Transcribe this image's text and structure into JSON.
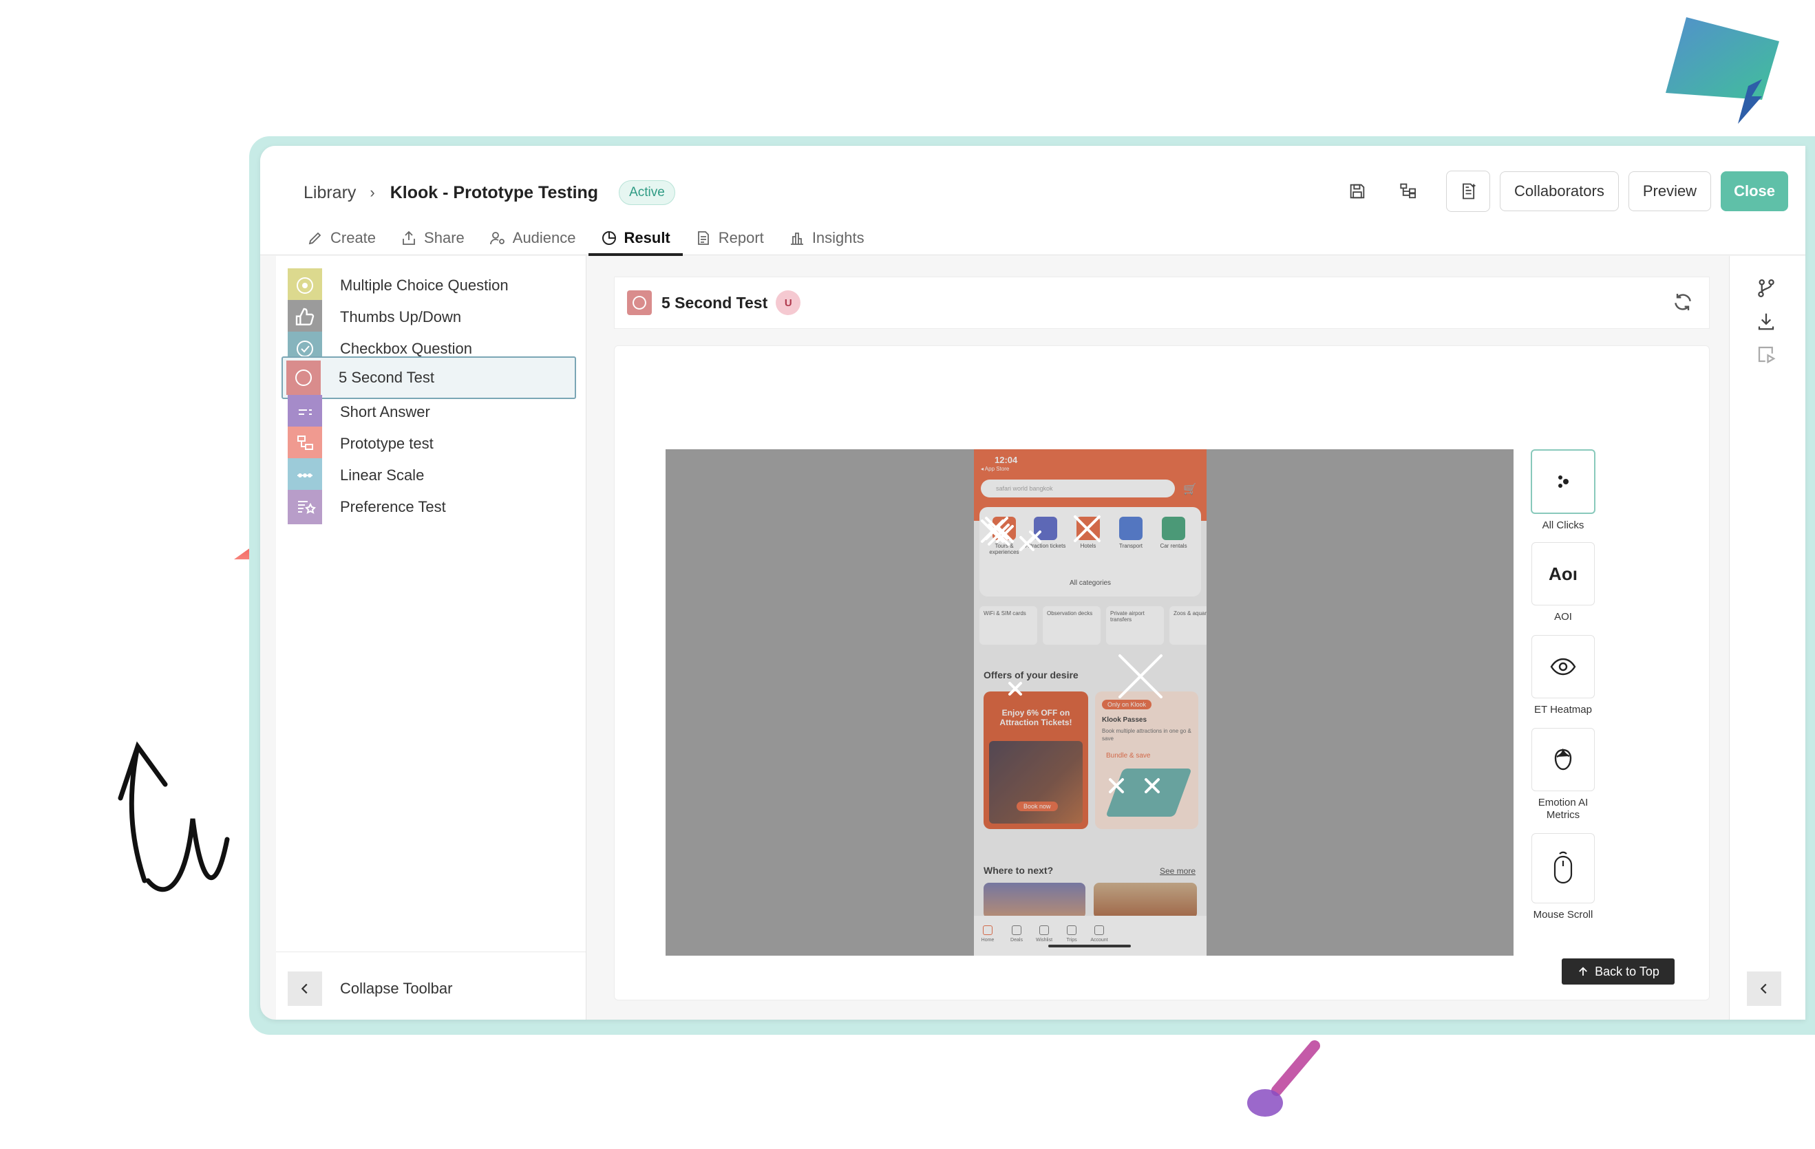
{
  "breadcrumb": {
    "root": "Library",
    "separator": "›",
    "project": "Klook - Prototype Testing",
    "status": "Active"
  },
  "toolbar": {
    "collaborators": "Collaborators",
    "preview": "Preview",
    "close": "Close"
  },
  "tabs": [
    {
      "label": "Create",
      "icon": "pencil-icon"
    },
    {
      "label": "Share",
      "icon": "share-icon"
    },
    {
      "label": "Audience",
      "icon": "audience-icon"
    },
    {
      "label": "Result",
      "icon": "pie-icon",
      "active": true
    },
    {
      "label": "Report",
      "icon": "report-icon"
    },
    {
      "label": "Insights",
      "icon": "bar-chart-icon"
    }
  ],
  "sidebar": {
    "items": [
      {
        "label": "Multiple Choice Question",
        "color": "#dcd98e"
      },
      {
        "label": "Thumbs Up/Down",
        "color": "#9b9b9b"
      },
      {
        "label": "Checkbox Question",
        "color": "#86b4bd"
      },
      {
        "label": "5 Second Test",
        "color": "#d98c8c",
        "selected": true
      },
      {
        "label": "Short Answer",
        "color": "#a58bc9"
      },
      {
        "label": "Prototype test",
        "color": "#f09a90"
      },
      {
        "label": "Linear Scale",
        "color": "#9ccbd9"
      },
      {
        "label": "Preference Test",
        "color": "#b89dc9"
      }
    ],
    "collapse": "Collapse Toolbar"
  },
  "result": {
    "title": "5 Second Test",
    "user_badge": "U"
  },
  "phone": {
    "time": "12:04",
    "app_store": "◂ App Store",
    "search_placeholder": "safari world bangkok",
    "categories": [
      "Tours & experiences",
      "Attraction tickets",
      "Hotels",
      "Transport",
      "Car rentals"
    ],
    "all_categories": "All categories",
    "chips": [
      "WiFi & SIM cards",
      "Observation decks",
      "Private airport transfers",
      "Zoos & aquariums"
    ],
    "offers_title": "Offers of your desire",
    "offer1_text": "Enjoy 6% OFF on Attraction Tickets!",
    "offer1_cta": "Book now",
    "offer2_pill": "Only on Klook",
    "offer2_title": "Klook Passes",
    "offer2_desc": "Book multiple attractions in one go & save",
    "offer2_bundle": "Bundle & save",
    "where_title": "Where to next?",
    "see_more": "See more",
    "tabbar": [
      "Home",
      "Deals",
      "Wishlist",
      "Trips",
      "Account"
    ]
  },
  "tools": [
    {
      "label": "All Clicks",
      "icon": "dots-icon",
      "selected": true
    },
    {
      "label": "AOI",
      "icon": "aoi-icon",
      "glyph": "Aoı"
    },
    {
      "label": "ET Heatmap",
      "icon": "eye-icon"
    },
    {
      "label": "Emotion AI Metrics",
      "icon": "emotion-icon"
    },
    {
      "label": "Mouse Scroll",
      "icon": "mouse-icon"
    }
  ],
  "back_to_top": "Back to Top",
  "colors": {
    "accent": "#5fc0a8",
    "frame": "#c7ebe6",
    "klook_orange": "#e9592d"
  }
}
